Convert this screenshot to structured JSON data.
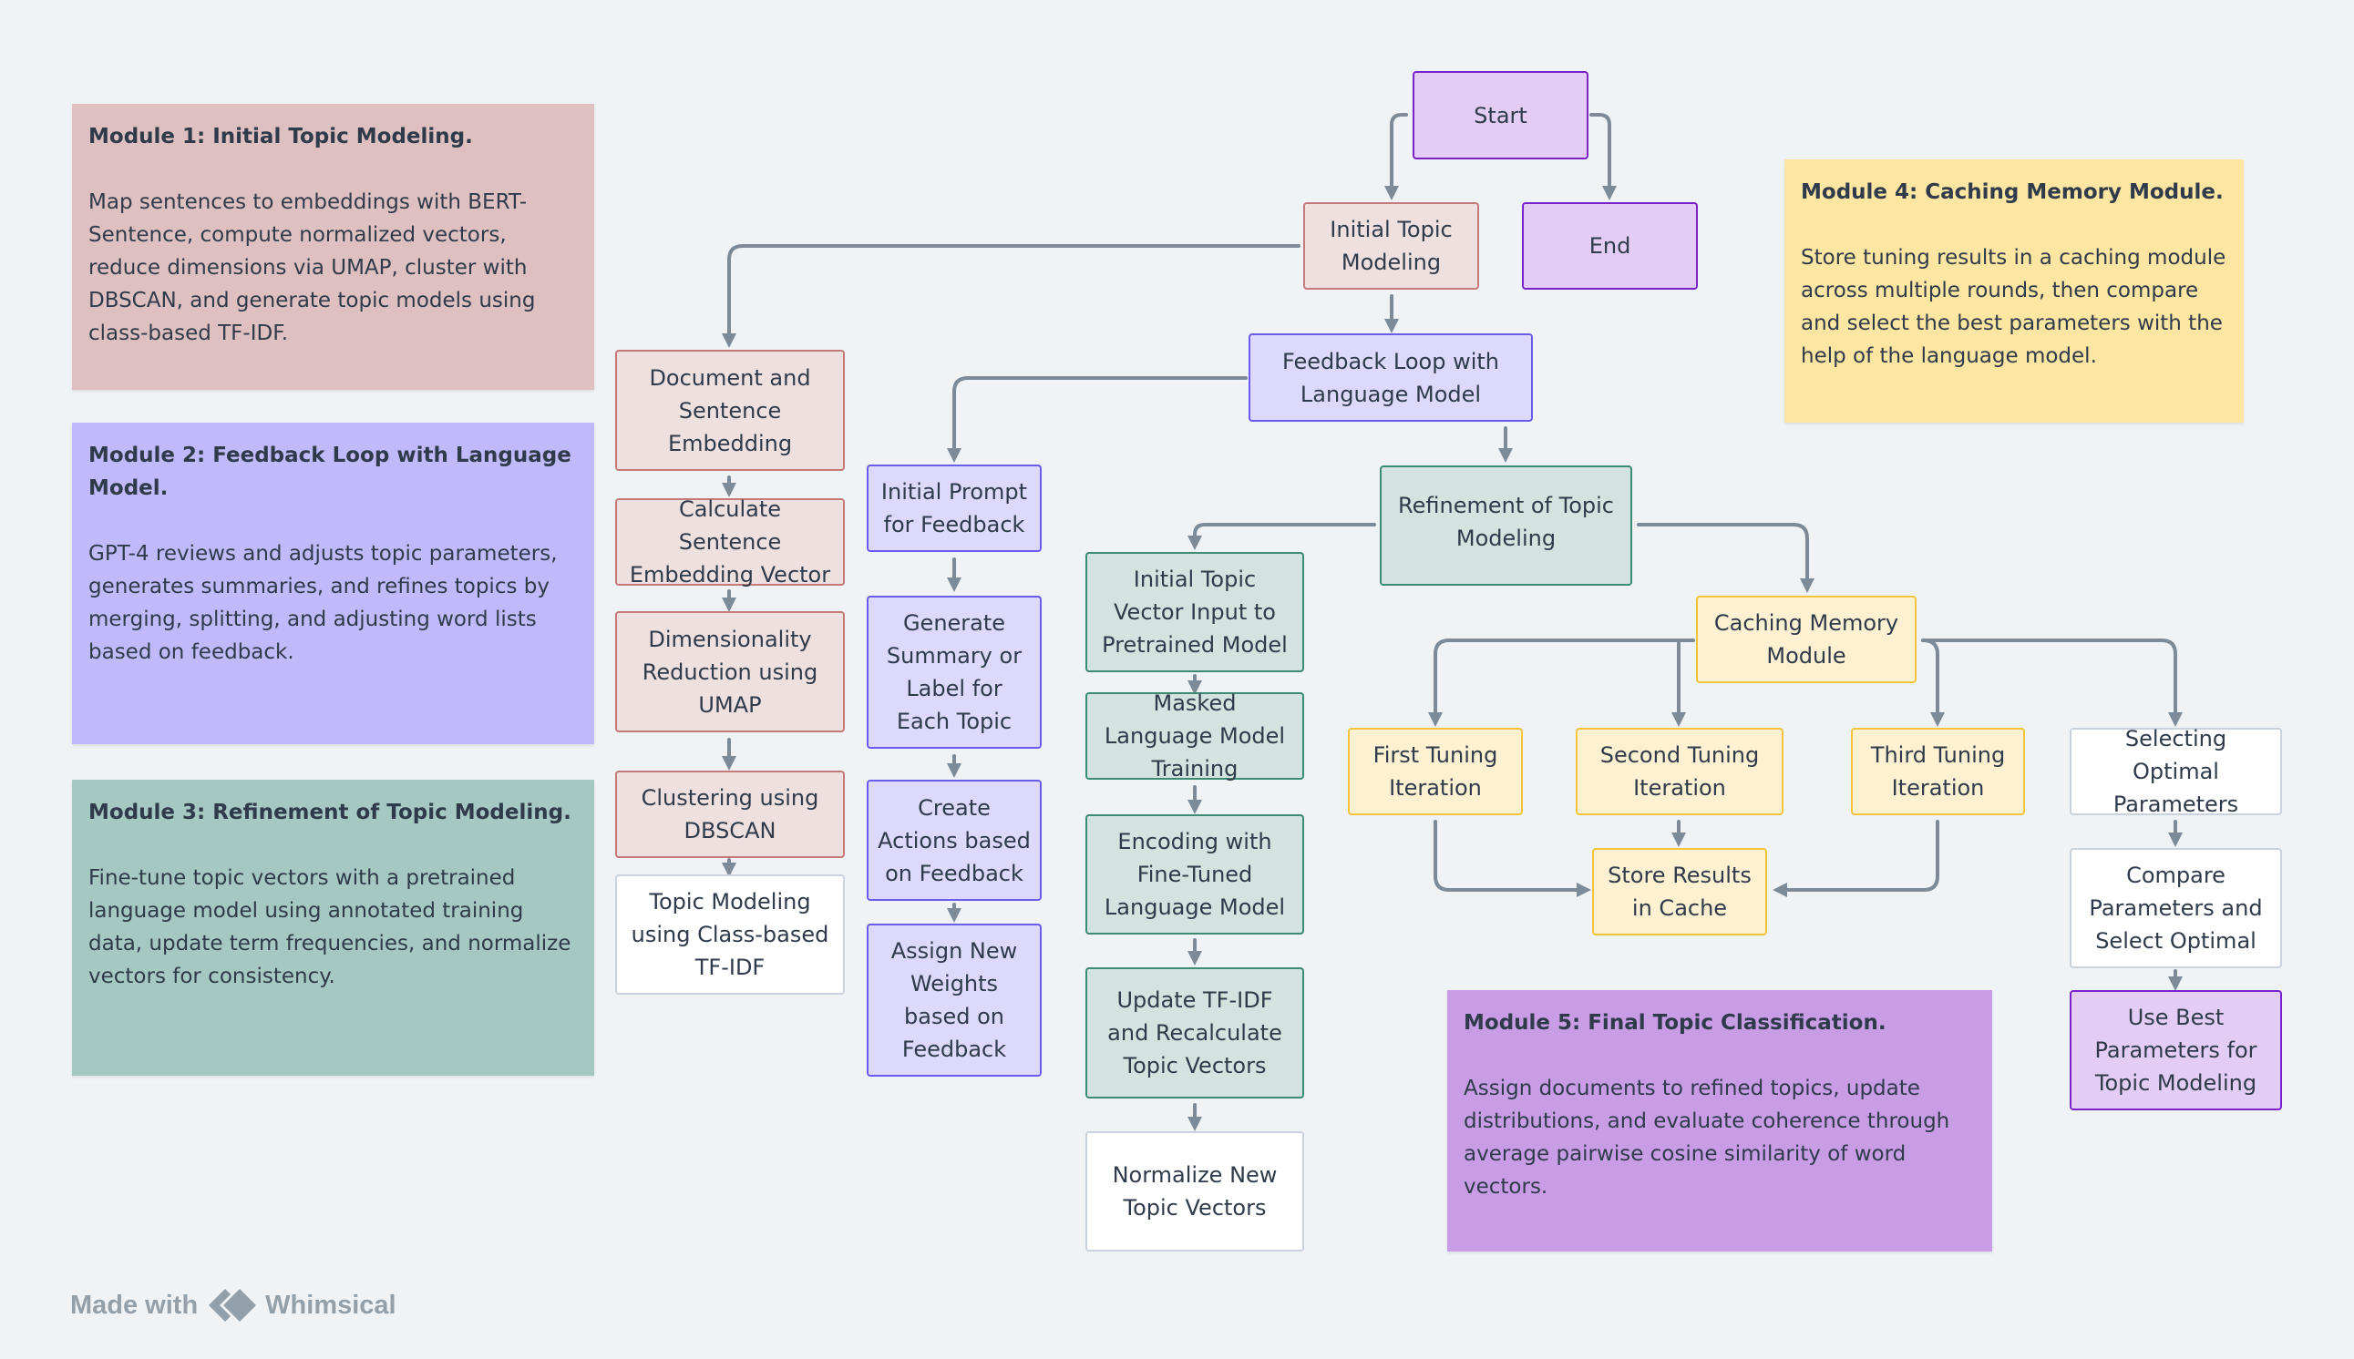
{
  "notes": [
    {
      "id": "module1",
      "title": "Module 1: Initial Topic Modeling.",
      "body": "Map sentences to embeddings with BERT-Sentence, compute normalized vectors, reduce dimensions via UMAP, cluster with DBSCAN, and generate topic models using class-based TF-IDF.",
      "color": "#dfc0c1"
    },
    {
      "id": "module2",
      "title": "Module 2: Feedback Loop with Language Model.",
      "body": "GPT-4 reviews and adjusts topic parameters, generates summaries, and refines topics by merging, splitting, and adjusting word lists based on feedback.",
      "color": "#c1bafa"
    },
    {
      "id": "module3",
      "title": "Module 3: Refinement of Topic Modeling.",
      "body": "Fine-tune topic vectors with a pretrained language model using annotated training data, update term frequencies, and normalize vectors for consistency.",
      "color": "#a6c8c2"
    },
    {
      "id": "module4",
      "title": "Module 4: Caching Memory Module.",
      "body": "Store tuning results in a caching module across multiple rounds, then compare and select the best parameters with the help of the language model.",
      "color": "#fde5a2"
    },
    {
      "id": "module5",
      "title": "Module 5: Final Topic Classification.",
      "body": "Assign documents to refined topics, update distributions, and evaluate coherence through average pairwise cosine similarity of word vectors.",
      "color": "#c89de6"
    }
  ],
  "nodes": {
    "start": "Start",
    "end": "End",
    "initial_topic_modeling": "Initial Topic Modeling",
    "feedback_loop": "Feedback Loop with Language Model",
    "refinement": "Refinement of Topic Modeling",
    "doc_sentence_embedding": "Document and Sentence Embedding",
    "calc_sentence_vector": "Calculate Sentence Embedding Vector",
    "dim_reduction": "Dimensionality Reduction using UMAP",
    "clustering": "Clustering using DBSCAN",
    "topic_modeling_ctfidf": "Topic Modeling using Class-based TF-IDF",
    "initial_prompt": "Initial Prompt for Feedback",
    "generate_summary": "Generate Summary or Label for Each Topic",
    "create_actions": "Create Actions based on Feedback",
    "assign_weights": "Assign New Weights based on Feedback",
    "initial_topic_vector": "Initial Topic Vector Input to Pretrained Model",
    "masked_lm": "Masked Language Model Training",
    "encoding_finetuned": "Encoding with Fine-Tuned Language Model",
    "update_tfidf": "Update TF-IDF and Recalculate Topic Vectors",
    "normalize_vectors": "Normalize New Topic Vectors",
    "caching_memory": "Caching Memory Module",
    "first_tuning": "First Tuning Iteration",
    "second_tuning": "Second Tuning Iteration",
    "third_tuning": "Third Tuning Iteration",
    "store_results": "Store Results in Cache",
    "selecting_optimal": "Selecting Optimal Parameters",
    "compare_params": "Compare Parameters and Select Optimal",
    "use_best": "Use Best Parameters for Topic Modeling"
  },
  "edges": [
    [
      "start",
      "initial_topic_modeling"
    ],
    [
      "start",
      "end"
    ],
    [
      "initial_topic_modeling",
      "doc_sentence_embedding"
    ],
    [
      "initial_topic_modeling",
      "feedback_loop"
    ],
    [
      "doc_sentence_embedding",
      "calc_sentence_vector"
    ],
    [
      "calc_sentence_vector",
      "dim_reduction"
    ],
    [
      "dim_reduction",
      "clustering"
    ],
    [
      "clustering",
      "topic_modeling_ctfidf"
    ],
    [
      "feedback_loop",
      "initial_prompt"
    ],
    [
      "feedback_loop",
      "refinement"
    ],
    [
      "initial_prompt",
      "generate_summary"
    ],
    [
      "generate_summary",
      "create_actions"
    ],
    [
      "create_actions",
      "assign_weights"
    ],
    [
      "refinement",
      "initial_topic_vector"
    ],
    [
      "refinement",
      "caching_memory"
    ],
    [
      "initial_topic_vector",
      "masked_lm"
    ],
    [
      "masked_lm",
      "encoding_finetuned"
    ],
    [
      "encoding_finetuned",
      "update_tfidf"
    ],
    [
      "update_tfidf",
      "normalize_vectors"
    ],
    [
      "caching_memory",
      "first_tuning"
    ],
    [
      "caching_memory",
      "second_tuning"
    ],
    [
      "caching_memory",
      "third_tuning"
    ],
    [
      "caching_memory",
      "selecting_optimal"
    ],
    [
      "first_tuning",
      "store_results"
    ],
    [
      "second_tuning",
      "store_results"
    ],
    [
      "third_tuning",
      "store_results"
    ],
    [
      "selecting_optimal",
      "compare_params"
    ],
    [
      "compare_params",
      "use_best"
    ]
  ],
  "colors": {
    "connector": "#7d8b98",
    "background": "#eff3f6"
  },
  "footer": {
    "made_with": "Made with",
    "brand": "Whimsical"
  }
}
